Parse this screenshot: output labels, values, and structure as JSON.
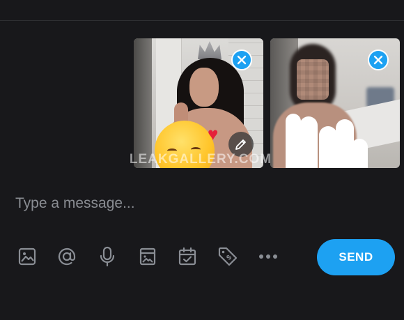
{
  "composer": {
    "placeholder": "Type a message...",
    "send_label": "SEND"
  },
  "watermark": "LEAKGALLERY.COM",
  "attachments": [
    {
      "icons": [
        "close-icon",
        "pencil-icon"
      ]
    },
    {
      "icons": [
        "close-icon"
      ]
    }
  ],
  "toolbar": {
    "icons": [
      "image-icon",
      "at-sign-icon",
      "microphone-icon",
      "gallery-vault-icon",
      "calendar-check-icon",
      "price-tag-icon",
      "more-dots-icon"
    ]
  },
  "colors": {
    "background": "#18181b",
    "accent": "#1da1f2",
    "icon": "#8a8e95",
    "placeholder": "#8a8d93"
  }
}
